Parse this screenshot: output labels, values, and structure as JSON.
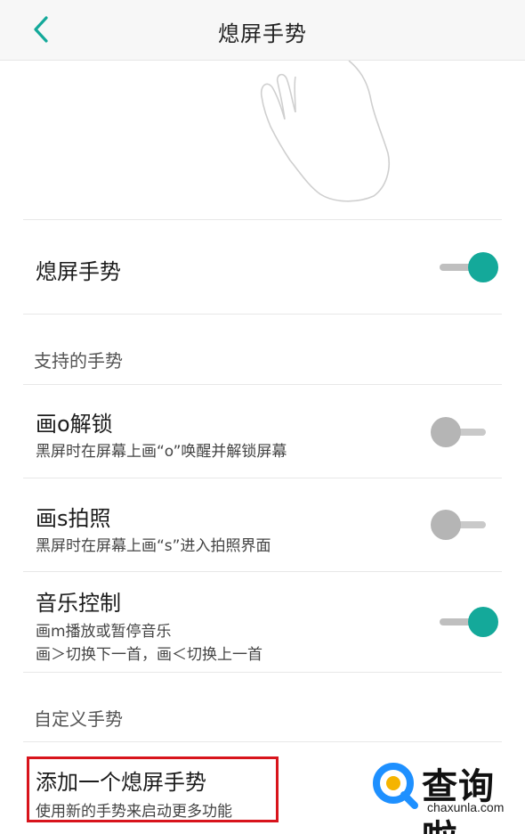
{
  "header": {
    "title": "熄屏手势",
    "back_icon": "chevron-left-icon"
  },
  "illustration": {
    "icon": "hand-gesture-icon"
  },
  "main_toggle": {
    "label": "熄屏手势",
    "enabled": true
  },
  "sections": {
    "supported": "支持的手势",
    "custom": "自定义手势"
  },
  "gestures": [
    {
      "title": "画o解锁",
      "subtitle": "黑屏时在屏幕上画“o”唤醒并解锁屏幕",
      "enabled": false
    },
    {
      "title": "画s拍照",
      "subtitle": "黑屏时在屏幕上画“s”进入拍照界面",
      "enabled": false
    },
    {
      "title": "音乐控制",
      "subtitle_line1": "画m播放或暂停音乐",
      "subtitle_line2": "画＞切换下一首，画＜切换上一首",
      "enabled": true
    }
  ],
  "add_gesture": {
    "title": "添加一个熄屏手势",
    "subtitle": "使用新的手势来启动更多功能"
  },
  "watermark": {
    "brand": "查询啦",
    "url": "chaxunla.com",
    "icon": "search-logo-icon"
  },
  "colors": {
    "accent": "#14a99a",
    "highlight": "#d8141c",
    "logo_blue": "#1e90ff",
    "logo_yellow": "#f5b400"
  }
}
